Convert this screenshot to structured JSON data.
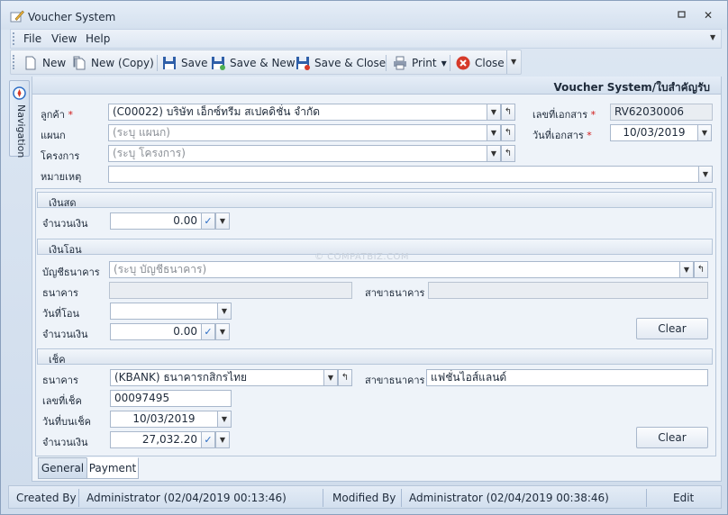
{
  "window": {
    "title": "Voucher System"
  },
  "menu": {
    "file": "File",
    "view": "View",
    "help": "Help"
  },
  "toolbar": {
    "new": "New",
    "new_copy": "New (Copy)",
    "save": "Save",
    "save_new": "Save & New",
    "save_close": "Save & Close",
    "print": "Print",
    "close": "Close"
  },
  "navigation": {
    "label": "Navigation"
  },
  "panel": {
    "title": "Voucher System/ใบสำคัญรับ"
  },
  "form": {
    "customer_label": "ลูกค้า",
    "customer_value": "(C00022) บริษัท เอ็กซ์ทรีม สเปคดิชั่น จำกัด",
    "department_label": "แผนก",
    "department_placeholder": "(ระบุ แผนก)",
    "project_label": "โครงการ",
    "project_placeholder": "(ระบุ โครงการ)",
    "note_label": "หมายเหตุ",
    "doc_no_label": "เลขที่เอกสาร",
    "doc_no_value": "RV62030006",
    "doc_date_label": "วันที่เอกสาร",
    "doc_date_value": "10/03/2019",
    "required_mark": "*"
  },
  "cash": {
    "title": "เงินสด",
    "amount_label": "จำนวนเงิน",
    "amount_value": "0.00"
  },
  "transfer": {
    "title": "เงินโอน",
    "account_label": "บัญชีธนาคาร",
    "account_placeholder": "(ระบุ บัญชีธนาคาร)",
    "bank_label": "ธนาคาร",
    "branch_label": "สาขาธนาคาร",
    "date_label": "วันที่โอน",
    "amount_label": "จำนวนเงิน",
    "amount_value": "0.00",
    "clear": "Clear"
  },
  "cheque": {
    "title": "เช็ค",
    "bank_label": "ธนาคาร",
    "bank_value": "(KBANK) ธนาคารกสิกรไทย",
    "branch_label": "สาขาธนาคาร",
    "branch_value": "แฟชั่นไอส์แลนด์",
    "number_label": "เลขที่เช็ค",
    "number_value": "00097495",
    "date_label": "วันที่บนเช็ค",
    "date_value": "10/03/2019",
    "amount_label": "จำนวนเงิน",
    "amount_value": "27,032.20",
    "clear": "Clear"
  },
  "tabs": {
    "general": "General",
    "payment": "Payment"
  },
  "status": {
    "created_by_label": "Created By",
    "created_by_value": "Administrator (02/04/2019 00:13:46)",
    "modified_by_label": "Modified By",
    "modified_by_value": "Administrator (02/04/2019 00:38:46)",
    "edit": "Edit"
  },
  "watermark": "© COMPATBIZ.COM",
  "colors": {
    "accent": "#2b6cc4",
    "required": "#d01818",
    "close_icon": "#d63a2a"
  }
}
